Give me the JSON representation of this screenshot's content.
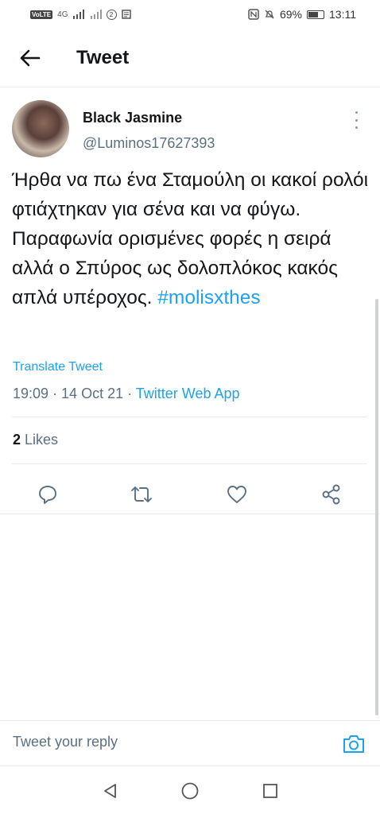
{
  "status_bar": {
    "volte": "VoLTE",
    "network": "4G",
    "circle_badge": "2",
    "battery_percent": "69%",
    "battery_level": 0.69,
    "time": "13:11"
  },
  "header": {
    "title": "Tweet"
  },
  "tweet": {
    "author_name": "Black Jasmine",
    "author_handle": "@Luminos17627393",
    "text": "Ήρθα να πω ένα Σταμούλη οι κακοί ρολόι φτιάχτηκαν για σένα και να φύγω. Παραφωνία ορισμένες φορές η σειρά αλλά ο Σπύρος ως δολοπλόκος κακός απλά υπέροχος. ",
    "hashtag": "#molisxthes",
    "translate_label": "Translate Tweet",
    "time": "19:09",
    "date": "14 Oct 21",
    "source": "Twitter Web App",
    "separator": " · ",
    "likes_count": "2",
    "likes_label": " Likes"
  },
  "actions": {
    "icons": [
      "reply-icon",
      "retweet-icon",
      "like-icon",
      "share-icon"
    ]
  },
  "reply": {
    "placeholder": "Tweet your reply"
  },
  "colors": {
    "accent": "#1da1f2",
    "secondary_text": "#5b7083",
    "primary_text": "#14171a",
    "divider": "#e6ecf0"
  }
}
